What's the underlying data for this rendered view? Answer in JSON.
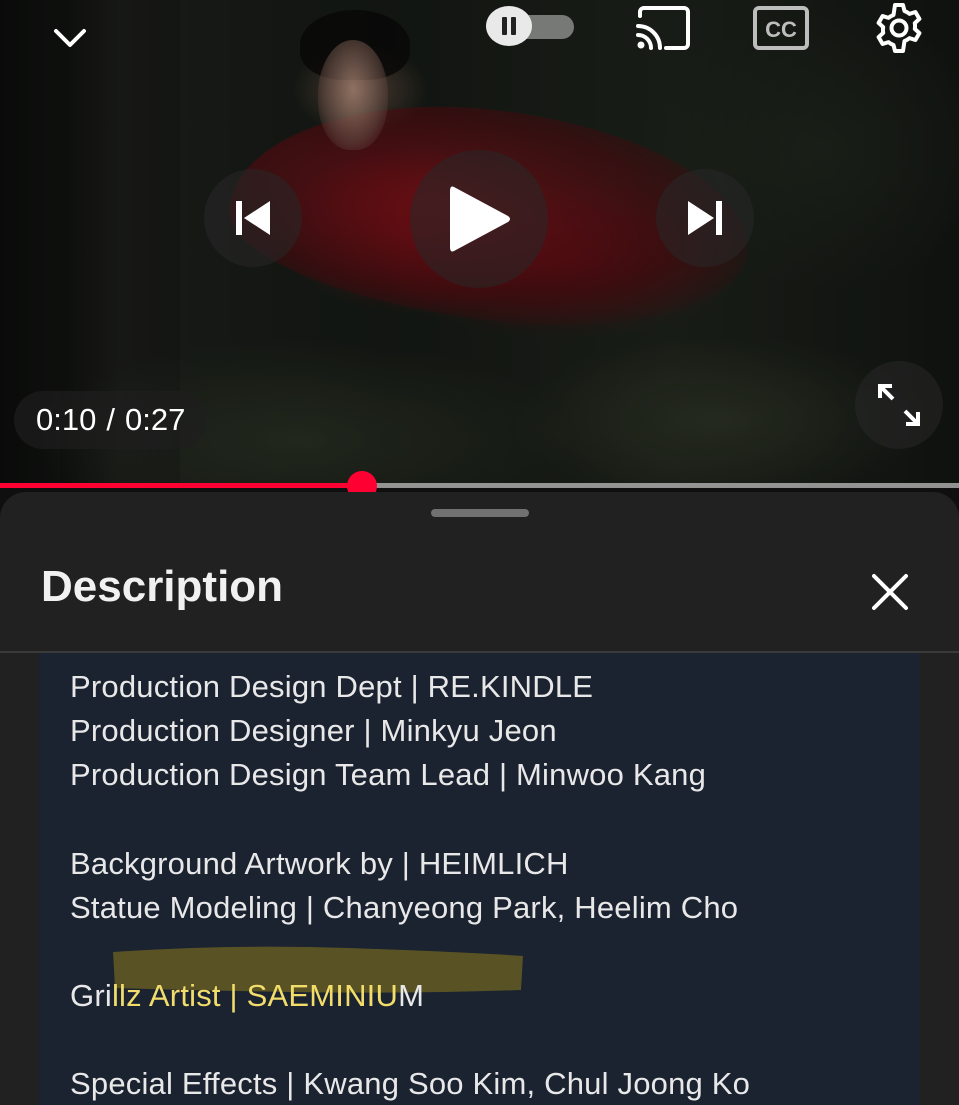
{
  "player": {
    "current_time": "0:10",
    "separator": "/",
    "duration": "0:27",
    "progress_fraction": 0.377,
    "accent_color": "#ff0033",
    "controls": {
      "collapse_icon": "chevron-down-icon",
      "autoplay_icon": "pause-icon",
      "cast_icon": "cast-icon",
      "captions_label": "CC",
      "settings_icon": "gear-icon",
      "previous_icon": "skip-previous-icon",
      "play_icon": "play-icon",
      "next_icon": "skip-next-icon",
      "fullscreen_icon": "fullscreen-icon"
    }
  },
  "description_panel": {
    "title": "Description",
    "close_icon": "close-icon",
    "highlight_color": "#f2dd6b",
    "lines": [
      "Production Design Dept | RE.KINDLE",
      "Production Designer | Minkyu Jeon",
      "Production Design Team Lead | Minwoo Kang",
      "Background Artwork by | HEIMLICH",
      "Statue Modeling | Chanyeong Park, Heelim Cho",
      "Special Effects | Kwang Soo Kim, Chul Joong Ko"
    ],
    "grillz_line": {
      "lead": "Gri",
      "highlighted": "llz Artist | SAEMINIU",
      "tail": "M"
    }
  }
}
